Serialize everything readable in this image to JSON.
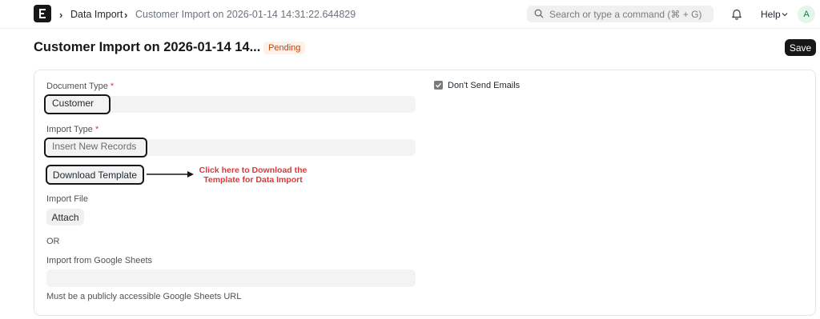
{
  "navbar": {
    "breadcrumbs": [
      "Data Import",
      "Customer Import on 2026-01-14 14:31:22.644829"
    ],
    "search_placeholder": "Search or type a command (⌘ + G)",
    "help_label": "Help",
    "avatar_initial": "A"
  },
  "page": {
    "title": "Customer Import on 2026-01-14 14...",
    "status": "Pending",
    "save_label": "Save"
  },
  "form": {
    "document_type": {
      "label": "Document Type",
      "required_mark": "*",
      "value": "Customer"
    },
    "import_type": {
      "label": "Import Type",
      "required_mark": "*",
      "value": "Insert New Records"
    },
    "download_template_label": "Download Template",
    "annotation_lines": [
      "Click here to Download the",
      "Template for Data Import"
    ],
    "import_file": {
      "label": "Import File",
      "button_label": "Attach"
    },
    "or_text": "OR",
    "google_sheets": {
      "label": "Import from Google Sheets",
      "value": "",
      "help": "Must be a publicly accessible Google Sheets URL"
    },
    "dont_send_emails": {
      "label": "Don't Send Emails",
      "checked": true
    }
  },
  "colors": {
    "accent": "#171717",
    "annotation": "#e03636",
    "pending_bg": "#fff1e7",
    "pending_text": "#c2410c"
  }
}
